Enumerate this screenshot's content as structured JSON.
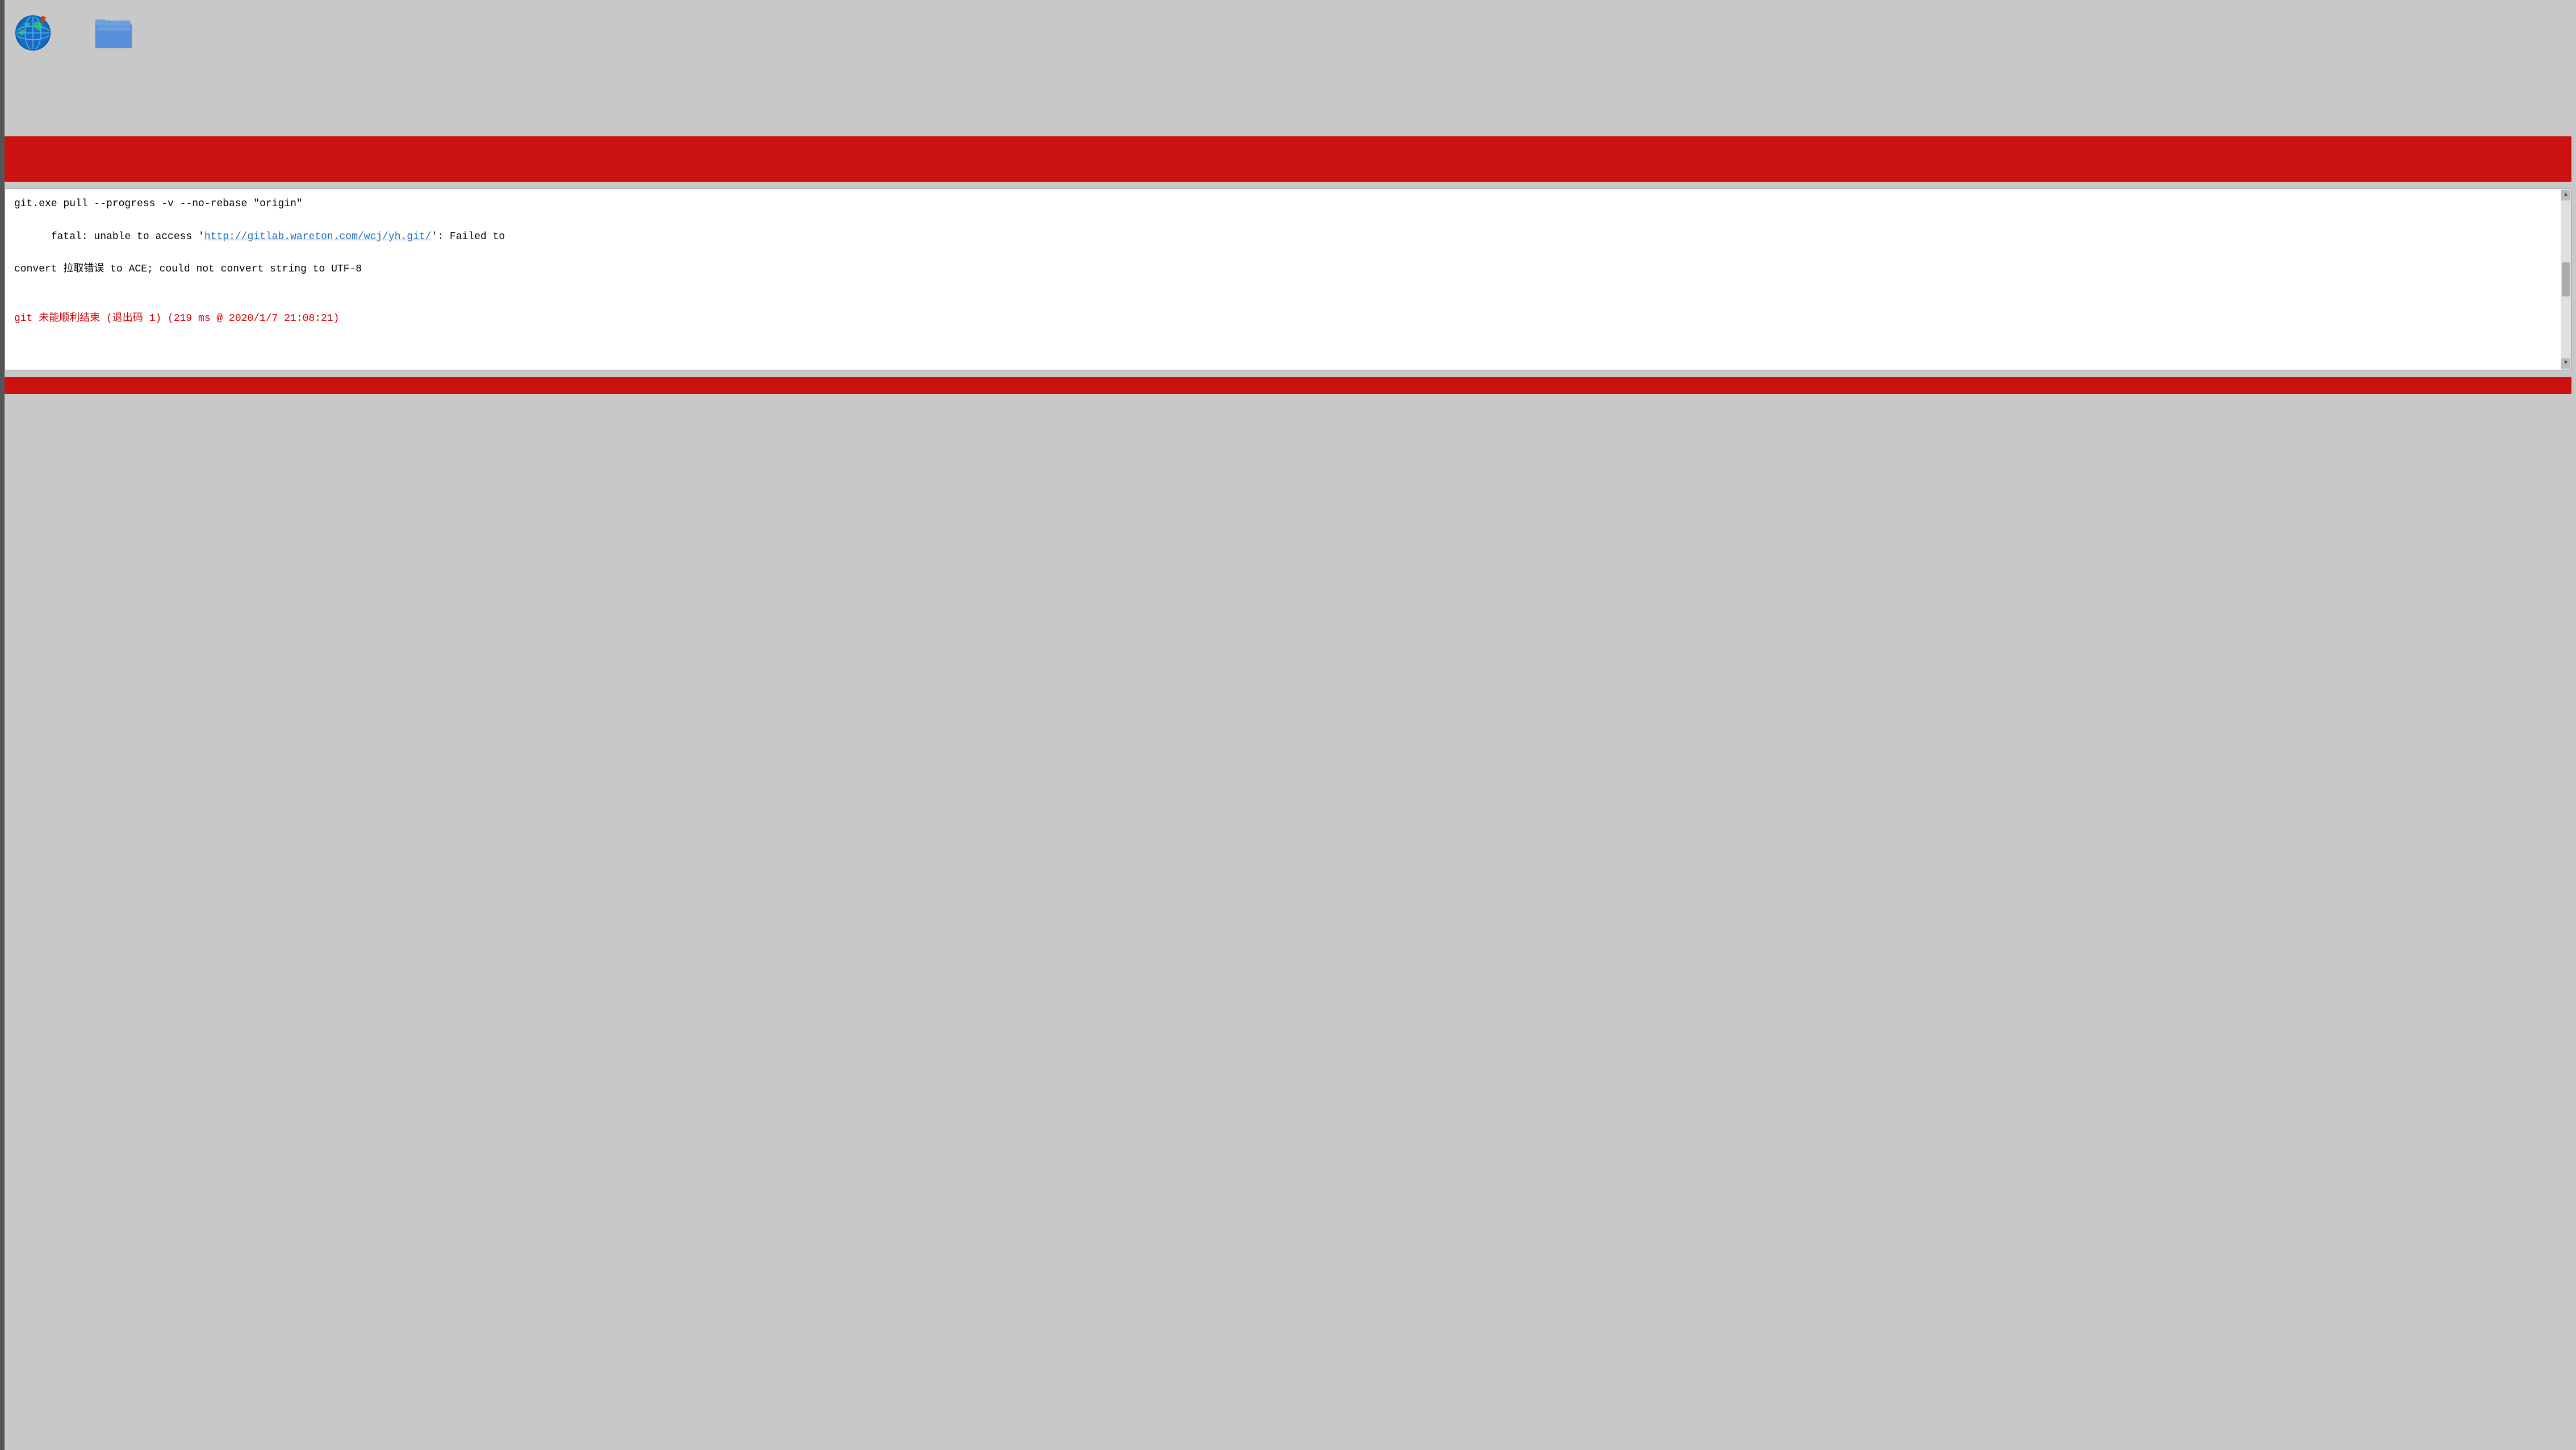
{
  "desktop": {
    "icons": [
      {
        "name": "internet-explorer",
        "type": "globe"
      },
      {
        "name": "folder",
        "type": "folder"
      }
    ]
  },
  "red_banner": {
    "color": "#cc1111"
  },
  "terminal": {
    "line1": "git.exe pull --progress -v --no-rebase \"origin\"",
    "line2_prefix": "fatal: unable to access '",
    "line2_link": "http://gitlab.wareton.com/wcj/yh.git/",
    "line2_suffix": "': Failed to",
    "line3": "convert 拉取错误 to ACE; could not convert string to UTF-8",
    "line_error": "git 未能顺利结束 (退出码 1) (219 ms @ 2020/1/7 21:08:21)"
  },
  "bottom_bar_color": "#cc1111"
}
